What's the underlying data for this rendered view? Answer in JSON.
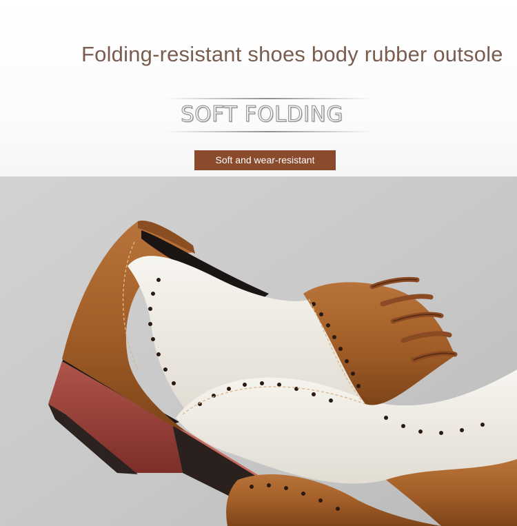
{
  "banner": {
    "headline": "Folding-resistant shoes body rubber outsole",
    "feature_title": "SOFT FOLDING",
    "tag_label": "Soft and wear-resistant"
  },
  "photo": {
    "subject": "shoe-photo",
    "colors": {
      "background": "#c9c9c9",
      "tan_leather": "#a9622a",
      "white_leather": "#eeeae2",
      "tag_brown": "#8a4a2c",
      "sole_red": "#9a3f38",
      "headline_brown": "#7a5d4f"
    }
  }
}
